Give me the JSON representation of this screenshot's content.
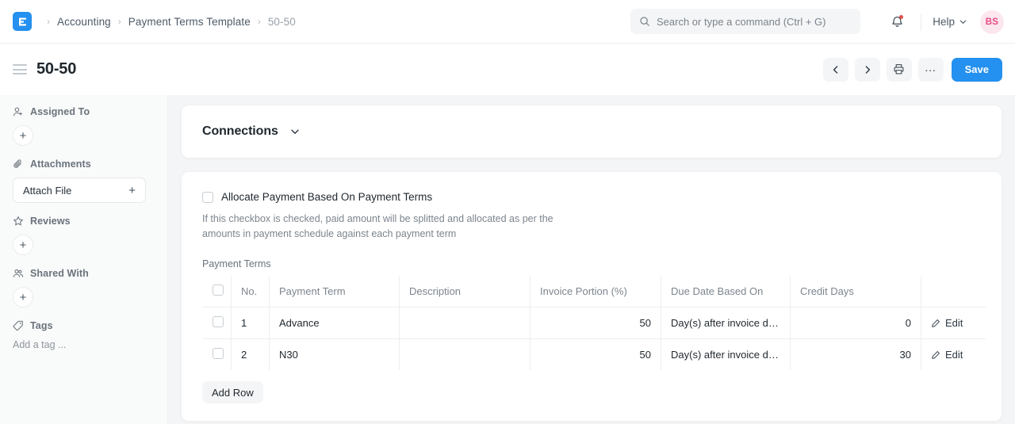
{
  "navbar": {
    "logo_alt": "erpnext-logo",
    "breadcrumbs": [
      {
        "label": "Accounting",
        "muted": false
      },
      {
        "label": "Payment Terms Template",
        "muted": false
      },
      {
        "label": "50-50",
        "muted": true
      }
    ],
    "separator": "›",
    "search": {
      "placeholder": "Search or type a command (Ctrl + G)",
      "value": ""
    },
    "help_label": "Help",
    "avatar_initials": "BS",
    "avatar_bg": "#fce7ef",
    "avatar_fg": "#e64980",
    "notification_dot_color": "#e24c4c"
  },
  "page_head": {
    "title": "50-50",
    "prev_label": "‹",
    "next_label": "›",
    "print_label": "Print",
    "more_label": "…",
    "save_label": "Save",
    "accent": "#2490ef"
  },
  "sidebar": {
    "sections": [
      {
        "title": "Assigned To",
        "icon": "user-plus-icon",
        "control": "plus-circle",
        "plus_label": "+"
      },
      {
        "title": "Attachments",
        "icon": "paperclip-icon",
        "control": "attach-button",
        "attach_label": "Attach File",
        "plus_label": "+"
      },
      {
        "title": "Reviews",
        "icon": "star-icon",
        "control": "plus-circle",
        "plus_label": "+"
      },
      {
        "title": "Shared With",
        "icon": "users-icon",
        "control": "plus-circle",
        "plus_label": "+"
      },
      {
        "title": "Tags",
        "icon": "tag-icon",
        "control": "tag-input",
        "tag_placeholder": "Add a tag ..."
      }
    ]
  },
  "main": {
    "connections": {
      "title": "Connections",
      "chevron": "chevron-down-icon"
    },
    "form": {
      "checkbox_label": "Allocate Payment Based On Payment Terms",
      "checkbox_checked": false,
      "help_text": "If this checkbox is checked, paid amount will be splitted and allocated as per the amounts in payment schedule against each payment term",
      "table_label": "Payment Terms",
      "add_row_label": "Add Row"
    },
    "table": {
      "columns": [
        {
          "key": "sel",
          "label": ""
        },
        {
          "key": "no",
          "label": "No."
        },
        {
          "key": "term",
          "label": "Payment Term"
        },
        {
          "key": "desc",
          "label": "Description"
        },
        {
          "key": "inv",
          "label": "Invoice Portion (%)"
        },
        {
          "key": "due",
          "label": "Due Date Based On"
        },
        {
          "key": "cd",
          "label": "Credit Days"
        },
        {
          "key": "act",
          "label": ""
        }
      ],
      "rows": [
        {
          "no": "1",
          "term": "Advance",
          "desc": "",
          "invoice_portion": "50",
          "due_date_based_on": "Day(s) after invoice da...",
          "credit_days": "0",
          "edit_label": "Edit",
          "selected": false
        },
        {
          "no": "2",
          "term": "N30",
          "desc": "",
          "invoice_portion": "50",
          "due_date_based_on": "Day(s) after invoice da...",
          "credit_days": "30",
          "edit_label": "Edit",
          "selected": false
        }
      ]
    }
  }
}
